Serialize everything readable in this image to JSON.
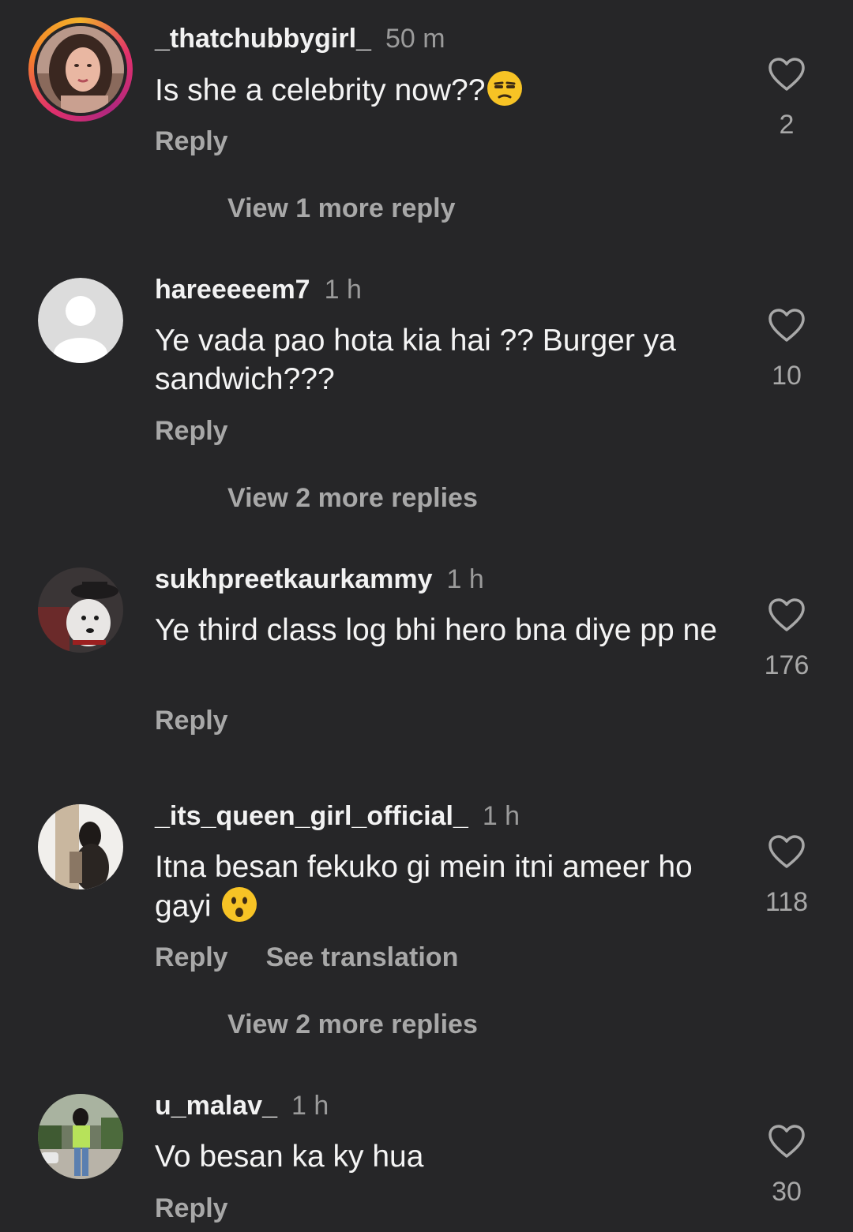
{
  "comments": [
    {
      "username": "_thatchubbygirl_",
      "time": "50 m",
      "text": "Is she a celebrity now??",
      "emoji": "unamused-face-emoji",
      "reply_label": "Reply",
      "likes": "2",
      "view_more": "View 1 more reply",
      "avatar": "profile-photo-girl",
      "story_ring": true
    },
    {
      "username": "hareeeeem7",
      "time": "1 h",
      "text": "Ye vada pao hota kia hai ?? Burger ya sandwich???",
      "reply_label": "Reply",
      "likes": "10",
      "view_more": "View 2 more replies",
      "avatar": "default-avatar"
    },
    {
      "username": "sukhpreetkaurkammy",
      "time": "1 h",
      "text": "Ye third class log bhi hero bna diye pp ne",
      "reply_label": "Reply",
      "likes": "176",
      "avatar": "profile-photo-dog"
    },
    {
      "username": "_its_queen_girl_official_",
      "time": "1 h",
      "text": "Itna besan fekuko gi mein itni ameer ho gayi ",
      "emoji": "astonished-face-emoji",
      "reply_label": "Reply",
      "translate_label": "See translation",
      "likes": "118",
      "view_more": "View 2 more replies",
      "avatar": "profile-photo-girl-mirror"
    },
    {
      "username": "u_malav_",
      "time": "1 h",
      "text": "Vo besan ka ky hua",
      "reply_label": "Reply",
      "likes": "30",
      "avatar": "profile-photo-person-outdoors"
    }
  ],
  "colors": {
    "background": "#262628",
    "primary_text": "#f2f2f2",
    "secondary_text": "#a8a8a8"
  }
}
